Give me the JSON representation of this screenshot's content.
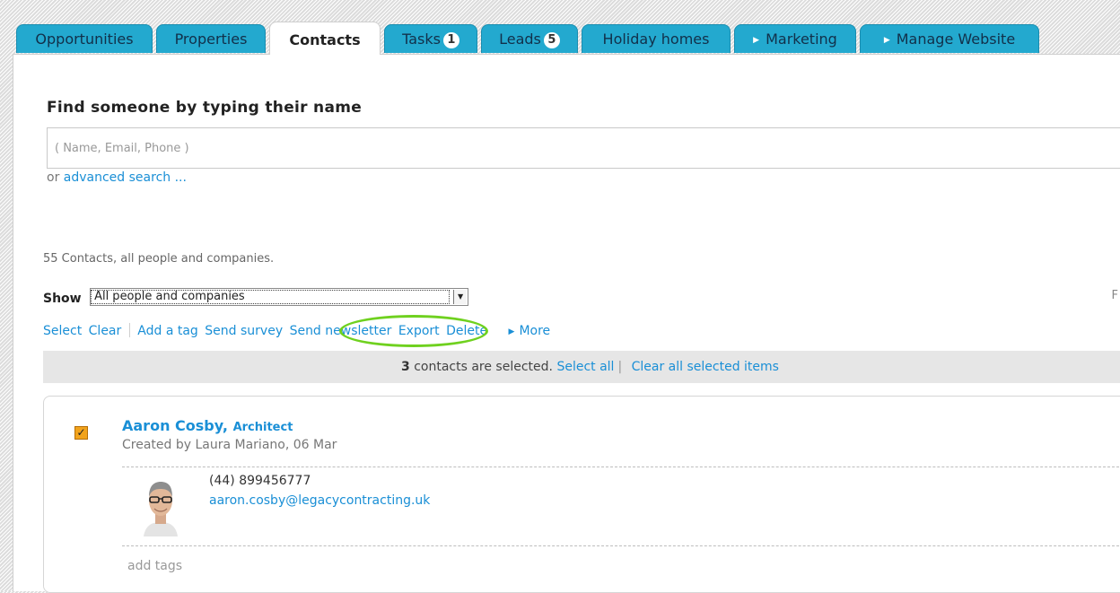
{
  "tabs": [
    {
      "label": "Opportunities"
    },
    {
      "label": "Properties"
    },
    {
      "label": "Contacts",
      "active": true
    },
    {
      "label": "Tasks",
      "badge": "1"
    },
    {
      "label": "Leads",
      "badge": "5"
    },
    {
      "label": "Holiday homes"
    },
    {
      "label": "Marketing",
      "icon": "arrow-right-icon"
    },
    {
      "label": "Manage Website",
      "icon": "arrow-right-icon"
    }
  ],
  "search": {
    "heading": "Find someone by typing their name",
    "placeholder": "( Name, Email, Phone )",
    "value": "",
    "or_text": "or",
    "advanced_link": "advanced search ..."
  },
  "summary": "55 Contacts, all people and companies.",
  "filter": {
    "label": "Show",
    "selected": "All people and companies",
    "right_edge_text": "F"
  },
  "actions": {
    "select": "Select",
    "clear": "Clear",
    "add_tag": "Add a tag",
    "send_survey": "Send survey",
    "send_newsletter": "Send newsletter",
    "export": "Export",
    "delete": "Delete",
    "more": "More"
  },
  "highlight_color": "#6fd11f",
  "selection": {
    "count": "3",
    "text": "contacts are selected.",
    "select_all": "Select all",
    "separator": "|",
    "clear_all": "Clear all selected items"
  },
  "contact": {
    "checked": true,
    "name": "Aaron Cosby,",
    "title": "Architect",
    "created": "Created by Laura Mariano, 06 Mar",
    "phone": "(44) 899456777",
    "email": "aaron.cosby@legacycontracting.uk",
    "add_tags": "add tags"
  },
  "colors": {
    "tab_bg": "#23a9cf",
    "link": "#1a8fd6",
    "checkbox": "#f2a31c"
  }
}
